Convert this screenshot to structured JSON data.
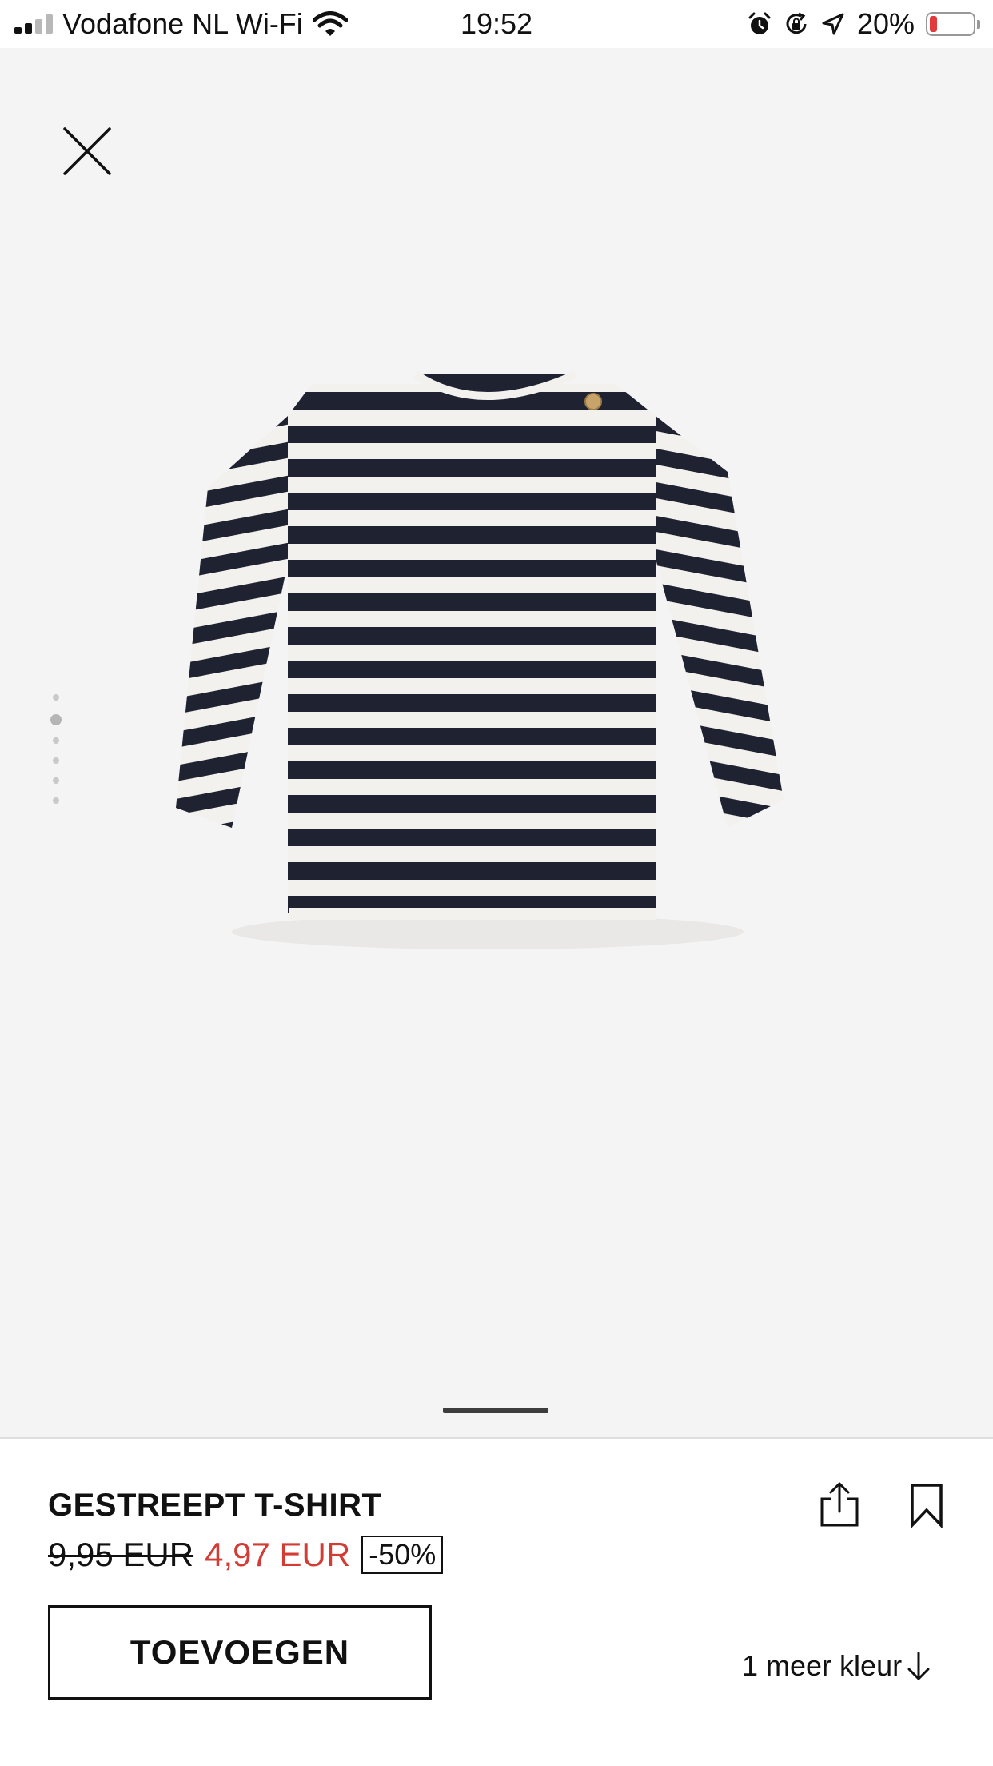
{
  "status_bar": {
    "carrier": "Vodafone NL Wi-Fi",
    "time": "19:52",
    "battery_percent": "20%",
    "battery_level": 0.2,
    "icons": [
      "signal-icon",
      "wifi-icon",
      "alarm-icon",
      "rotation-lock-icon",
      "location-icon",
      "battery-icon"
    ]
  },
  "gallery": {
    "image_count": 6,
    "active_index": 1,
    "product_image": "striped-long-sleeve-shirt"
  },
  "product": {
    "name": "GESTREEPT T-SHIRT",
    "old_price": "9,95 EUR",
    "new_price": "4,97 EUR",
    "discount": "-50%",
    "add_label": "TOEVOEGEN",
    "more_colors_label": "1 meer kleur"
  },
  "colors": {
    "sale_red": "#d33c35",
    "image_background": "#f5f4f4",
    "stripe_navy": "#1f2230",
    "stripe_white": "#f2f1ee"
  }
}
